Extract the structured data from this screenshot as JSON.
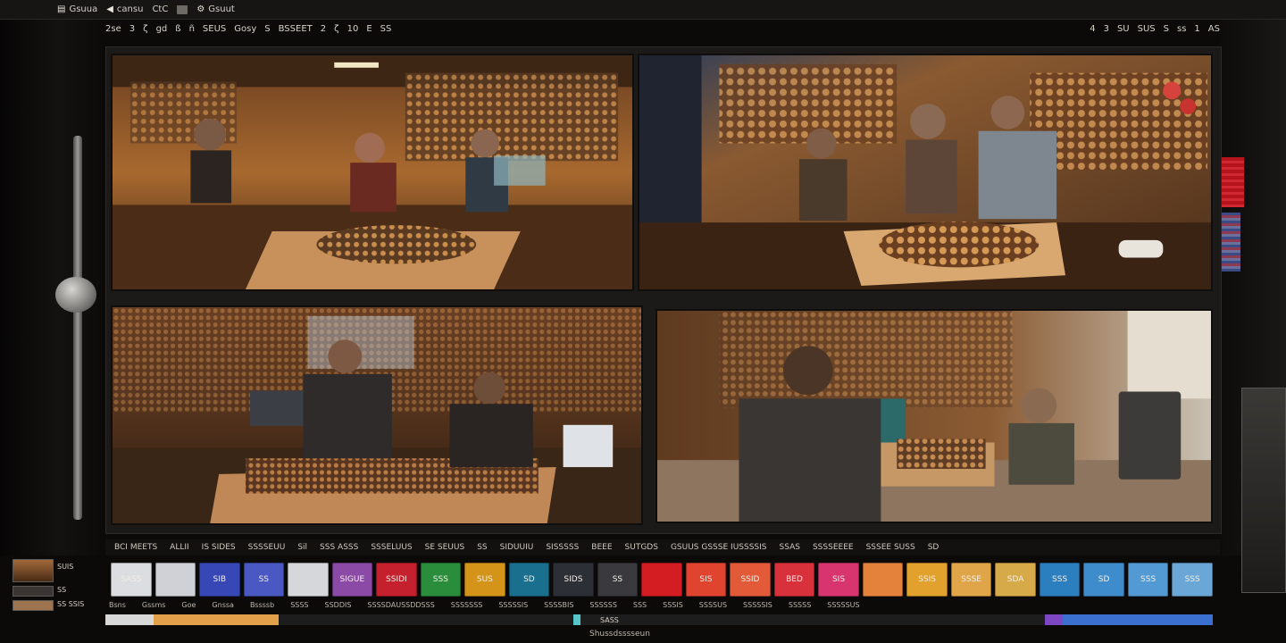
{
  "topbar": {
    "items": [
      {
        "icon": "doc-icon",
        "label": "Gsuua"
      },
      {
        "icon": "speaker-icon",
        "label": "cansu"
      },
      {
        "icon": "",
        "label": "CtC"
      },
      {
        "icon": "window-icon",
        "label": ""
      },
      {
        "icon": "settings-icon",
        "label": "Gsuut"
      }
    ]
  },
  "toolbar": {
    "left": [
      "2se",
      "3",
      "ζ",
      "gd",
      "ß",
      "ñ",
      "SEUS",
      "Gosy",
      "S",
      "BSSEET",
      "2",
      "ζ",
      "10",
      "E",
      "SS"
    ],
    "right": [
      "4",
      "3",
      "SU",
      "SUS",
      "S",
      "ss",
      "1",
      "AS"
    ]
  },
  "labels_row": [
    "BCI MEETS",
    "ALLII",
    "IS SIDES",
    "SSSSEUU",
    "Sil",
    "SSS ASSS",
    "SSSELUUS",
    "SE SEUUS",
    "SS",
    "SIDUUIU",
    "SISSSSS",
    "BEEE",
    "SUTGDS",
    "GSUUS GSSSE IUSSSSIS",
    "SSAS",
    "SSSSEEEE",
    "SSSEE SUSS",
    "SD"
  ],
  "palette": [
    {
      "label": "SASS",
      "color": "#dcdde0"
    },
    {
      "label": "",
      "color": "#cfd1d6"
    },
    {
      "label": "SIB",
      "color": "#3747b6"
    },
    {
      "label": "SS",
      "color": "#4a58c4"
    },
    {
      "label": "",
      "color": "#d6d7db"
    },
    {
      "label": "SIGUE",
      "color": "#8b4aa6"
    },
    {
      "label": "SSIDI",
      "color": "#c4202e"
    },
    {
      "label": "SSS",
      "color": "#2a8d3c"
    },
    {
      "label": "SUS",
      "color": "#d49419"
    },
    {
      "label": "SD",
      "color": "#1a6f8e"
    },
    {
      "label": "SIDS",
      "color": "#2d2f36"
    },
    {
      "label": "SS",
      "color": "#3a3a3e"
    },
    {
      "label": "",
      "color": "#d31d22"
    },
    {
      "label": "SIS",
      "color": "#e0432e"
    },
    {
      "label": "SSID",
      "color": "#e35a39"
    },
    {
      "label": "BED",
      "color": "#d9313b"
    },
    {
      "label": "SIS",
      "color": "#d8356f"
    },
    {
      "label": "",
      "color": "#e4813a"
    },
    {
      "label": "SSIS",
      "color": "#e2a02d"
    },
    {
      "label": "SSSE",
      "color": "#e0a548"
    },
    {
      "label": "SDA",
      "color": "#d7aa49"
    },
    {
      "label": "SSS",
      "color": "#2b7fbf"
    },
    {
      "label": "SD",
      "color": "#3f8ccd"
    },
    {
      "label": "SSS",
      "color": "#5399d3"
    },
    {
      "label": "SSS",
      "color": "#6aa7d6"
    }
  ],
  "sublabels": [
    "Bsns",
    "Gssms",
    "Goe",
    "Gnssa",
    "Bssssb",
    "SSSS",
    "SSDDIS",
    "SSSSDAUSSDDSSS",
    "SSSSSSS",
    "SSSSSIS",
    "SSSSBIS",
    "SSSSSS",
    "SSS",
    "SSSIS",
    "SSSSUS",
    "SSSSSIS",
    "SSSSS",
    "SSSSSUS"
  ],
  "footer_label": "Shussdsssseun",
  "bottom_mid_text": "SASS",
  "thumbs": [
    {
      "label": "SUIS"
    },
    {
      "label": "SS"
    },
    {
      "label": "SS SSIS"
    }
  ],
  "bottom_bar": [
    {
      "color": "#d8d8d8",
      "w": 54
    },
    {
      "color": "#e3a04b",
      "w": 140
    },
    {
      "color": "#1d1d1d",
      "w": 330
    },
    {
      "color": "#57c5c9",
      "w": 8
    },
    {
      "color": "#1d1d1d",
      "w": 520
    },
    {
      "color": "#7d46c2",
      "w": 20
    },
    {
      "color": "#3b6fd0",
      "w": 168
    }
  ]
}
